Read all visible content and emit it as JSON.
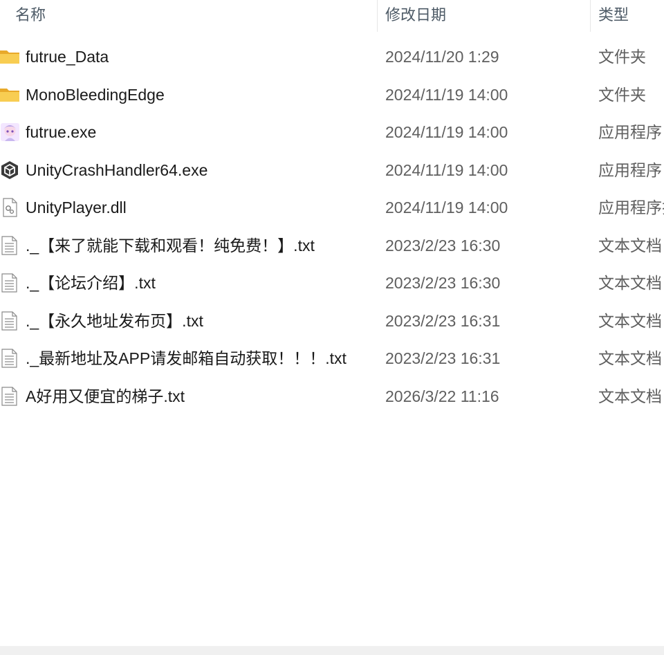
{
  "columns": {
    "name": "名称",
    "date": "修改日期",
    "type": "类型"
  },
  "files": [
    {
      "name": "futrue_Data",
      "date": "2024/11/20 1:29",
      "type": "文件夹",
      "icon": "folder-icon"
    },
    {
      "name": "MonoBleedingEdge",
      "date": "2024/11/19 14:00",
      "type": "文件夹",
      "icon": "folder-icon"
    },
    {
      "name": "futrue.exe",
      "date": "2024/11/19 14:00",
      "type": "应用程序",
      "icon": "app-anime-icon"
    },
    {
      "name": "UnityCrashHandler64.exe",
      "date": "2024/11/19 14:00",
      "type": "应用程序",
      "icon": "unity-icon"
    },
    {
      "name": "UnityPlayer.dll",
      "date": "2024/11/19 14:00",
      "type": "应用程序扩",
      "icon": "dll-icon"
    },
    {
      "name": "._【来了就能下载和观看！纯免费！】.txt",
      "date": "2023/2/23 16:30",
      "type": "文本文档",
      "icon": "text-file-icon"
    },
    {
      "name": "._【论坛介绍】.txt",
      "date": "2023/2/23 16:30",
      "type": "文本文档",
      "icon": "text-file-icon"
    },
    {
      "name": "._【永久地址发布页】.txt",
      "date": "2023/2/23 16:31",
      "type": "文本文档",
      "icon": "text-file-icon"
    },
    {
      "name": "._最新地址及APP请发邮箱自动获取！！！.txt",
      "date": "2023/2/23 16:31",
      "type": "文本文档",
      "icon": "text-file-icon"
    },
    {
      "name": "A好用又便宜的梯子.txt",
      "date": "2026/3/22 11:16",
      "type": "文本文档",
      "icon": "text-file-icon"
    }
  ]
}
